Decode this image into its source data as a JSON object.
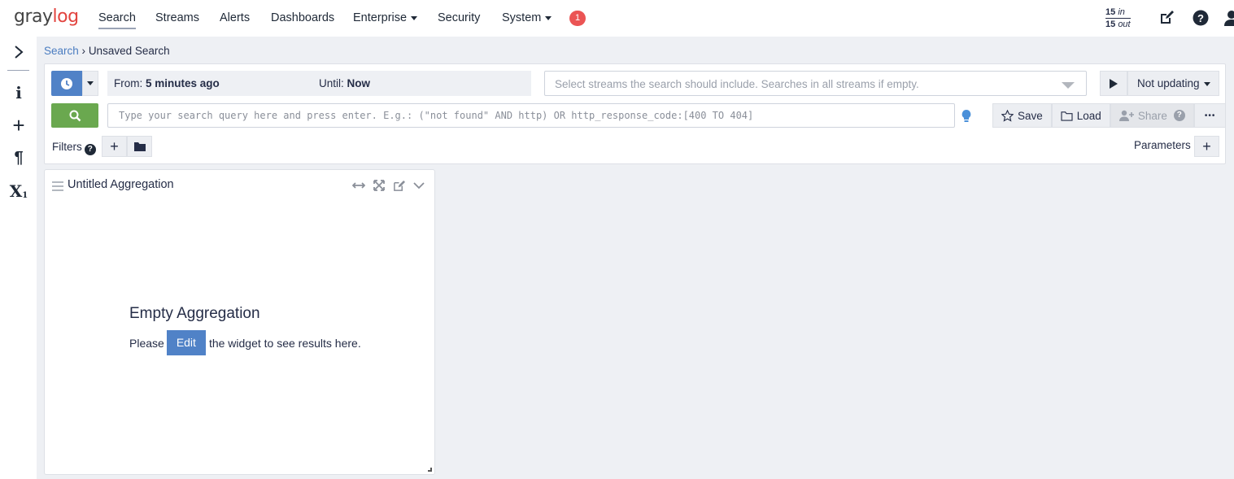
{
  "nav": {
    "logo_gray": "gray",
    "logo_log": "log",
    "items": [
      {
        "label": "Search"
      },
      {
        "label": "Streams"
      },
      {
        "label": "Alerts"
      },
      {
        "label": "Dashboards"
      },
      {
        "label": "Enterprise"
      },
      {
        "label": "Security"
      },
      {
        "label": "System"
      }
    ],
    "notification_count": "1",
    "throughput": {
      "in_value": "15",
      "in_label": "in",
      "out_value": "15",
      "out_label": "out"
    }
  },
  "sidebar": {
    "icons": [
      "chevron-right-icon",
      "info-icon",
      "plus-icon",
      "paragraph-icon",
      "subscript-x-icon"
    ],
    "info_glyph": "i",
    "plus_glyph": "+",
    "paragraph_glyph": "¶",
    "x_glyph": "X",
    "x_sub": "1"
  },
  "breadcrumb": {
    "link": "Search",
    "separator": "›",
    "current": "Unsaved Search"
  },
  "search": {
    "from_label": "From:",
    "from_value": "5 minutes ago",
    "until_label": "Until:",
    "until_value": "Now",
    "streams_placeholder": "Select streams the search should include. Searches in all streams if empty.",
    "refresh_label": "Not updating",
    "query_placeholder": "Type your search query here and press enter. E.g.: (\"not found\" AND http) OR http_response_code:[400 TO 404]",
    "save_label": "Save",
    "load_label": "Load",
    "share_label": "Share",
    "share_help": "?",
    "more_label": "•••",
    "filters_label": "Filters",
    "filters_help": "?",
    "add_glyph": "+",
    "parameters_label": "Parameters"
  },
  "widget": {
    "title": "Untitled Aggregation",
    "empty_title": "Empty Aggregation",
    "empty_before": "Please",
    "edit_label": "Edit",
    "empty_after": "the widget to see results here."
  },
  "colors": {
    "primary": "#5082c7",
    "success": "#6aa84f",
    "danger": "#eb5454",
    "logo_accent": "#e2443f"
  }
}
